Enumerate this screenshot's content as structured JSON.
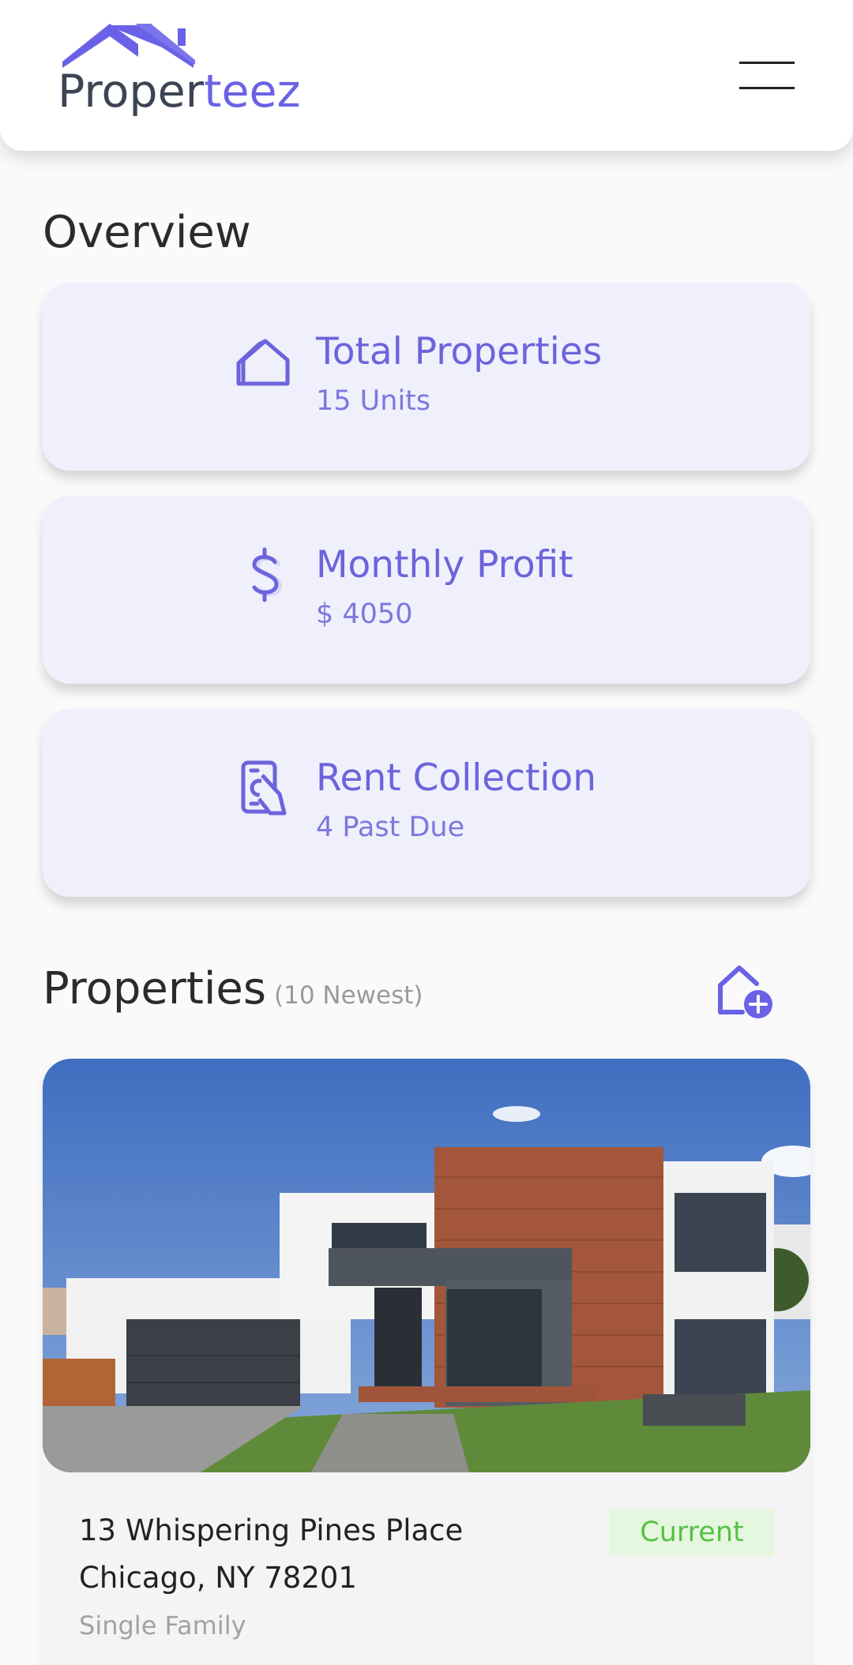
{
  "brand": {
    "name_part1": "Proper",
    "name_part2": "teez"
  },
  "header": {
    "menu_icon": "hamburger-menu-icon"
  },
  "overview": {
    "title": "Overview",
    "cards": [
      {
        "title": "Total Properties",
        "value": "15 Units",
        "icon": "house-icon"
      },
      {
        "title": "Monthly Profit",
        "value": "$ 4050",
        "icon": "dollar-icon"
      },
      {
        "title": "Rent Collection",
        "value": "4 Past Due",
        "icon": "rent-payment-icon"
      }
    ]
  },
  "properties": {
    "title": "Properties",
    "subtitle": "(10 Newest)",
    "add_icon": "add-property-icon",
    "items": [
      {
        "address_line1": "13 Whispering Pines Place",
        "address_line2": "Chicago, NY 78201",
        "type": "Single Family",
        "status": "Current"
      }
    ]
  },
  "colors": {
    "accent": "#6a62e6",
    "card_bg": "#f0effc",
    "status_bg": "#e5f8df",
    "status_text": "#56c045"
  }
}
